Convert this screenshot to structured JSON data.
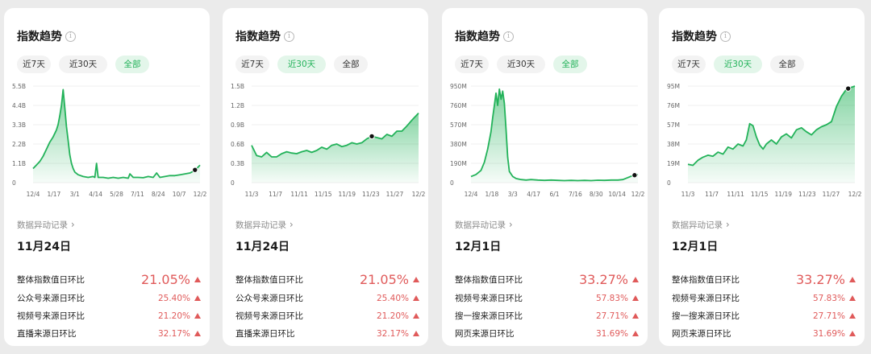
{
  "cards": [
    {
      "title": "指数趋势",
      "tabs": [
        "近7天",
        "近30天",
        "全部"
      ],
      "active_tab": 2,
      "link_label": "数据异动记录",
      "date_label": "11月24日",
      "metrics": [
        {
          "label": "整体指数值日环比",
          "value": "21.05%"
        },
        {
          "label": "公众号来源日环比",
          "value": "25.40%"
        },
        {
          "label": "视频号来源日环比",
          "value": "21.20%"
        },
        {
          "label": "直播来源日环比",
          "value": "32.17%"
        }
      ],
      "chart_data": {
        "type": "area",
        "y_ticks": [
          "0",
          "1.1B",
          "2.2B",
          "3.3B",
          "4.4B",
          "5.5B"
        ],
        "y_tick_values": [
          0,
          1.1,
          2.2,
          3.3,
          4.4,
          5.5
        ],
        "x_ticks": [
          "12/4",
          "1/17",
          "3/1",
          "4/14",
          "5/28",
          "7/11",
          "8/24",
          "10/7",
          "12/2"
        ],
        "ylim": [
          0,
          5.5
        ],
        "unit": "B",
        "x_count": 100,
        "points": [
          [
            0,
            0.8
          ],
          [
            2,
            1.0
          ],
          [
            4,
            1.2
          ],
          [
            6,
            1.5
          ],
          [
            8,
            1.9
          ],
          [
            10,
            2.3
          ],
          [
            12,
            2.6
          ],
          [
            14,
            3.0
          ],
          [
            15,
            3.3
          ],
          [
            16,
            3.8
          ],
          [
            17,
            4.4
          ],
          [
            18,
            5.3
          ],
          [
            19,
            4.3
          ],
          [
            20,
            3.2
          ],
          [
            21,
            2.4
          ],
          [
            22,
            1.6
          ],
          [
            23,
            1.1
          ],
          [
            24,
            0.8
          ],
          [
            25,
            0.6
          ],
          [
            27,
            0.45
          ],
          [
            30,
            0.35
          ],
          [
            33,
            0.3
          ],
          [
            36,
            0.35
          ],
          [
            37,
            0.3
          ],
          [
            38,
            1.1
          ],
          [
            39,
            0.3
          ],
          [
            42,
            0.3
          ],
          [
            45,
            0.25
          ],
          [
            48,
            0.3
          ],
          [
            51,
            0.25
          ],
          [
            54,
            0.3
          ],
          [
            57,
            0.25
          ],
          [
            58,
            0.5
          ],
          [
            60,
            0.3
          ],
          [
            63,
            0.3
          ],
          [
            66,
            0.28
          ],
          [
            69,
            0.35
          ],
          [
            72,
            0.3
          ],
          [
            74,
            0.55
          ],
          [
            76,
            0.3
          ],
          [
            79,
            0.35
          ],
          [
            82,
            0.4
          ],
          [
            85,
            0.4
          ],
          [
            88,
            0.45
          ],
          [
            91,
            0.5
          ],
          [
            94,
            0.55
          ],
          [
            96,
            0.65
          ],
          [
            98,
            0.8
          ],
          [
            100,
            1.0
          ]
        ],
        "marker_x": 97,
        "grid": true,
        "legend": "none"
      }
    },
    {
      "title": "指数趋势",
      "tabs": [
        "近7天",
        "近30天",
        "全部"
      ],
      "active_tab": 1,
      "link_label": "数据异动记录",
      "date_label": "11月24日",
      "metrics": [
        {
          "label": "整体指数值日环比",
          "value": "21.05%"
        },
        {
          "label": "公众号来源日环比",
          "value": "25.40%"
        },
        {
          "label": "视频号来源日环比",
          "value": "21.20%"
        },
        {
          "label": "直播来源日环比",
          "value": "32.17%"
        }
      ],
      "chart_data": {
        "type": "area",
        "y_ticks": [
          "0",
          "0.3B",
          "0.6B",
          "0.9B",
          "1.2B",
          "1.5B"
        ],
        "y_tick_values": [
          0,
          0.3,
          0.6,
          0.9,
          1.2,
          1.5
        ],
        "x_ticks": [
          "11/3",
          "11/7",
          "11/11",
          "11/15",
          "11/19",
          "11/23",
          "11/27",
          "12/2"
        ],
        "ylim": [
          0,
          1.5
        ],
        "unit": "B",
        "x_count": 100,
        "points": [
          [
            0,
            0.58
          ],
          [
            3,
            0.42
          ],
          [
            6,
            0.4
          ],
          [
            9,
            0.47
          ],
          [
            12,
            0.4
          ],
          [
            15,
            0.4
          ],
          [
            18,
            0.45
          ],
          [
            21,
            0.48
          ],
          [
            24,
            0.46
          ],
          [
            27,
            0.45
          ],
          [
            30,
            0.48
          ],
          [
            33,
            0.5
          ],
          [
            36,
            0.47
          ],
          [
            39,
            0.5
          ],
          [
            42,
            0.55
          ],
          [
            45,
            0.52
          ],
          [
            48,
            0.58
          ],
          [
            51,
            0.6
          ],
          [
            54,
            0.56
          ],
          [
            57,
            0.58
          ],
          [
            60,
            0.62
          ],
          [
            63,
            0.6
          ],
          [
            66,
            0.62
          ],
          [
            69,
            0.68
          ],
          [
            72,
            0.72
          ],
          [
            75,
            0.7
          ],
          [
            78,
            0.68
          ],
          [
            81,
            0.75
          ],
          [
            84,
            0.72
          ],
          [
            87,
            0.8
          ],
          [
            90,
            0.8
          ],
          [
            93,
            0.88
          ],
          [
            96,
            0.97
          ],
          [
            100,
            1.08
          ]
        ],
        "marker_x": 72,
        "grid": true,
        "legend": "none"
      }
    },
    {
      "title": "指数趋势",
      "tabs": [
        "近7天",
        "近30天",
        "全部"
      ],
      "active_tab": 2,
      "link_label": "数据异动记录",
      "date_label": "12月1日",
      "metrics": [
        {
          "label": "整体指数值日环比",
          "value": "33.27%"
        },
        {
          "label": "视频号来源日环比",
          "value": "57.83%"
        },
        {
          "label": "搜一搜来源日环比",
          "value": "27.71%"
        },
        {
          "label": "网页来源日环比",
          "value": "31.69%"
        }
      ],
      "chart_data": {
        "type": "area",
        "y_ticks": [
          "0",
          "190M",
          "380M",
          "570M",
          "760M",
          "950M"
        ],
        "y_tick_values": [
          0,
          190,
          380,
          570,
          760,
          950
        ],
        "x_ticks": [
          "12/4",
          "1/18",
          "3/3",
          "4/17",
          "6/1",
          "7/16",
          "8/30",
          "10/14",
          "12/2"
        ],
        "ylim": [
          0,
          950
        ],
        "unit": "M",
        "x_count": 100,
        "points": [
          [
            0,
            60
          ],
          [
            3,
            80
          ],
          [
            6,
            120
          ],
          [
            8,
            200
          ],
          [
            10,
            330
          ],
          [
            12,
            500
          ],
          [
            13,
            640
          ],
          [
            14,
            760
          ],
          [
            15,
            880
          ],
          [
            16,
            760
          ],
          [
            17,
            920
          ],
          [
            18,
            820
          ],
          [
            19,
            900
          ],
          [
            20,
            780
          ],
          [
            21,
            520
          ],
          [
            22,
            250
          ],
          [
            23,
            110
          ],
          [
            25,
            60
          ],
          [
            27,
            40
          ],
          [
            30,
            30
          ],
          [
            33,
            25
          ],
          [
            36,
            30
          ],
          [
            40,
            25
          ],
          [
            44,
            22
          ],
          [
            48,
            25
          ],
          [
            52,
            22
          ],
          [
            56,
            20
          ],
          [
            60,
            22
          ],
          [
            64,
            20
          ],
          [
            68,
            22
          ],
          [
            72,
            20
          ],
          [
            76,
            24
          ],
          [
            80,
            22
          ],
          [
            84,
            25
          ],
          [
            88,
            25
          ],
          [
            91,
            30
          ],
          [
            94,
            50
          ],
          [
            97,
            70
          ],
          [
            100,
            80
          ]
        ],
        "marker_x": 98,
        "grid": true,
        "legend": "none"
      }
    },
    {
      "title": "指数趋势",
      "tabs": [
        "近7天",
        "近30天",
        "全部"
      ],
      "active_tab": 1,
      "link_label": "数据异动记录",
      "date_label": "12月1日",
      "metrics": [
        {
          "label": "整体指数值日环比",
          "value": "33.27%"
        },
        {
          "label": "视频号来源日环比",
          "value": "57.83%"
        },
        {
          "label": "搜一搜来源日环比",
          "value": "27.71%"
        },
        {
          "label": "网页来源日环比",
          "value": "31.69%"
        }
      ],
      "chart_data": {
        "type": "area",
        "y_ticks": [
          "0",
          "19M",
          "38M",
          "57M",
          "76M",
          "95M"
        ],
        "y_tick_values": [
          0,
          19,
          38,
          57,
          76,
          95
        ],
        "x_ticks": [
          "11/3",
          "11/7",
          "11/11",
          "11/15",
          "11/19",
          "11/23",
          "11/27",
          "12/2"
        ],
        "ylim": [
          0,
          95
        ],
        "unit": "M",
        "x_count": 100,
        "points": [
          [
            0,
            18
          ],
          [
            3,
            17
          ],
          [
            6,
            22
          ],
          [
            9,
            25
          ],
          [
            12,
            27
          ],
          [
            15,
            26
          ],
          [
            18,
            30
          ],
          [
            21,
            28
          ],
          [
            24,
            35
          ],
          [
            27,
            33
          ],
          [
            30,
            38
          ],
          [
            33,
            36
          ],
          [
            35,
            42
          ],
          [
            37,
            58
          ],
          [
            39,
            56
          ],
          [
            41,
            45
          ],
          [
            43,
            37
          ],
          [
            45,
            33
          ],
          [
            47,
            38
          ],
          [
            50,
            42
          ],
          [
            53,
            38
          ],
          [
            56,
            45
          ],
          [
            59,
            48
          ],
          [
            62,
            44
          ],
          [
            65,
            52
          ],
          [
            68,
            54
          ],
          [
            71,
            50
          ],
          [
            74,
            47
          ],
          [
            77,
            52
          ],
          [
            80,
            55
          ],
          [
            83,
            57
          ],
          [
            86,
            60
          ],
          [
            89,
            75
          ],
          [
            92,
            85
          ],
          [
            95,
            92
          ],
          [
            100,
            95
          ]
        ],
        "marker_x": 96,
        "grid": true,
        "legend": "none"
      }
    }
  ],
  "colors": {
    "line": "#22b259",
    "area_top": "#22b259",
    "accent_tab_bg": "#e3f6ea",
    "increase": "#e05a5a",
    "grid": "#efefef",
    "axis_text": "#666666",
    "marker": "#111111"
  },
  "icons": {
    "info": "info-circle-icon",
    "chevron": "chevron-right-icon",
    "increase": "triangle-up-icon"
  }
}
